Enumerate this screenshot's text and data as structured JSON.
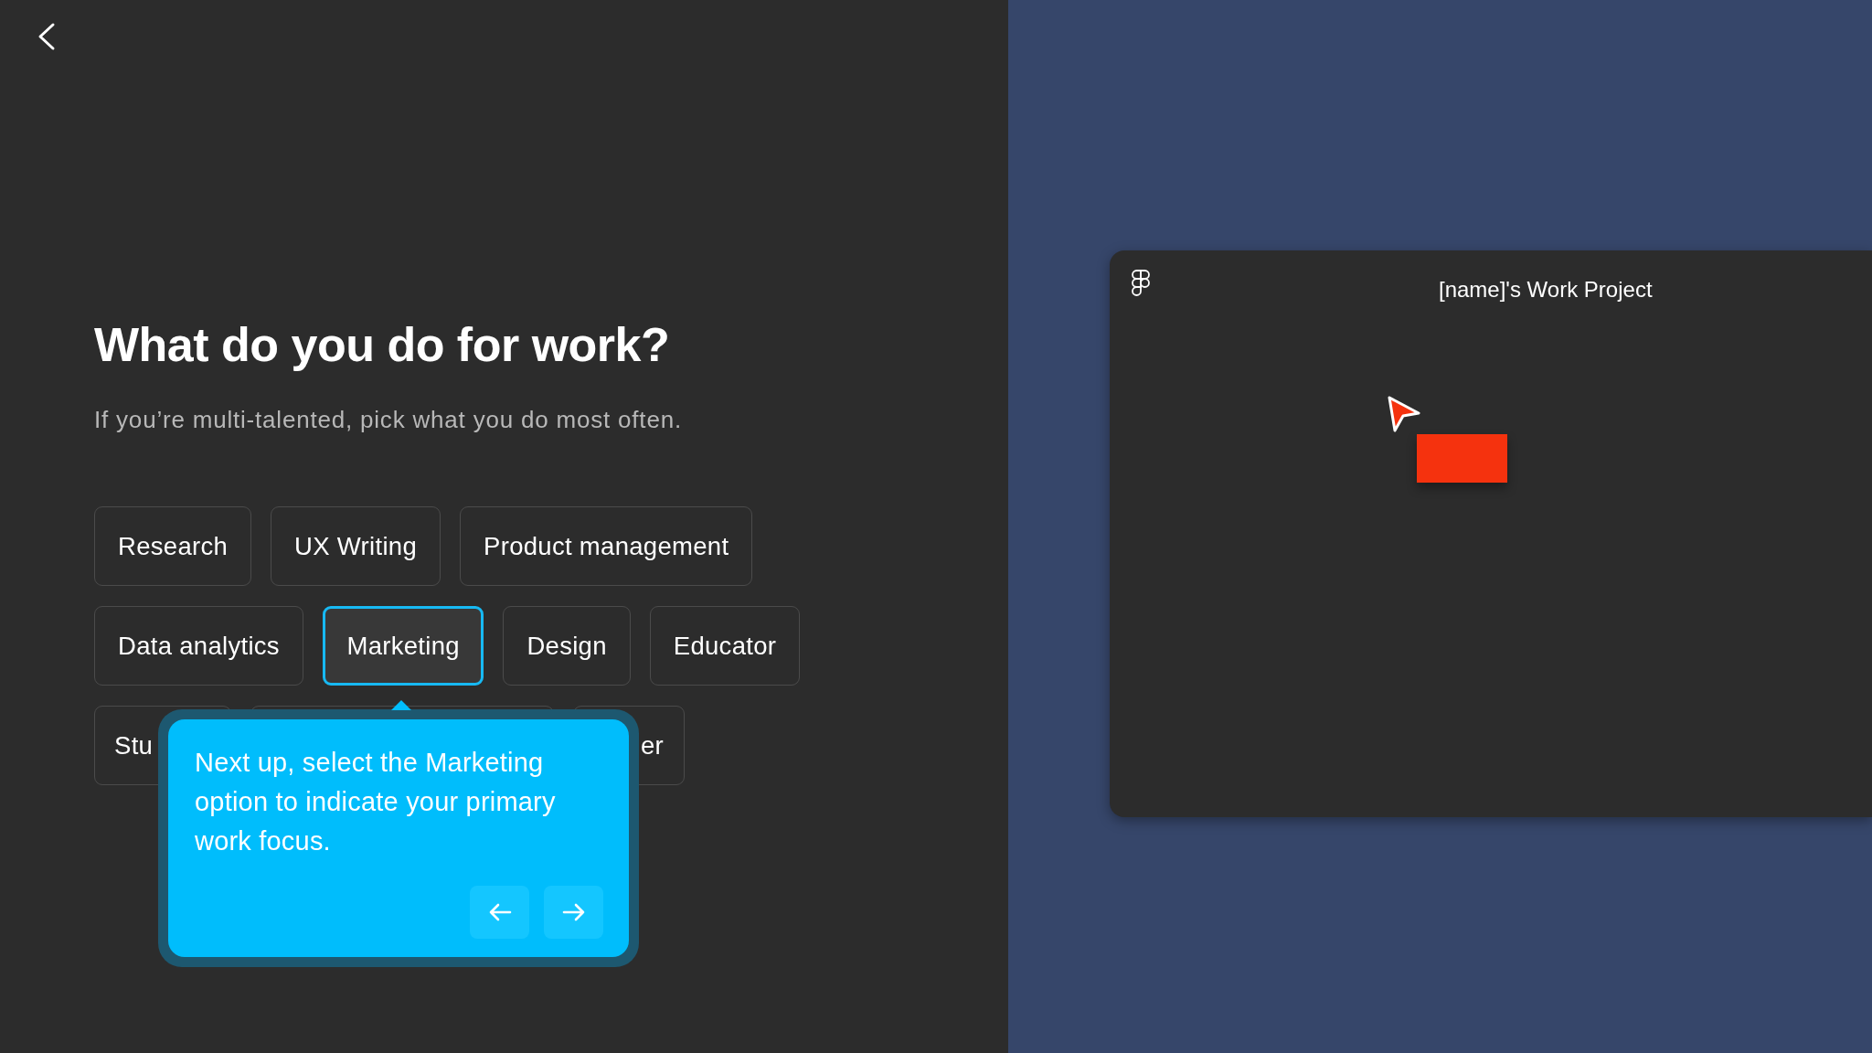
{
  "heading": "What do you do for work?",
  "subtitle": "If you’re multi-talented, pick what you do most often.",
  "option_rows": [
    [
      {
        "label": "Research",
        "selected": false
      },
      {
        "label": "UX Writing",
        "selected": false
      },
      {
        "label": "Product management",
        "selected": false
      }
    ],
    [
      {
        "label": "Data analytics",
        "selected": false
      },
      {
        "label": "Marketing",
        "selected": true
      },
      {
        "label": "Design",
        "selected": false
      },
      {
        "label": "Educator",
        "selected": false
      }
    ],
    [
      {
        "label": "Stu",
        "selected": false,
        "kind": "trailing"
      },
      {
        "selected": false,
        "kind": "hidden"
      },
      {
        "label": "er",
        "selected": false,
        "kind": "leading"
      }
    ]
  ],
  "tooltip": {
    "text": "Next up, select the Marketing option to indicate your primary work focus."
  },
  "preview": {
    "title": "[name]'s Work Project"
  }
}
